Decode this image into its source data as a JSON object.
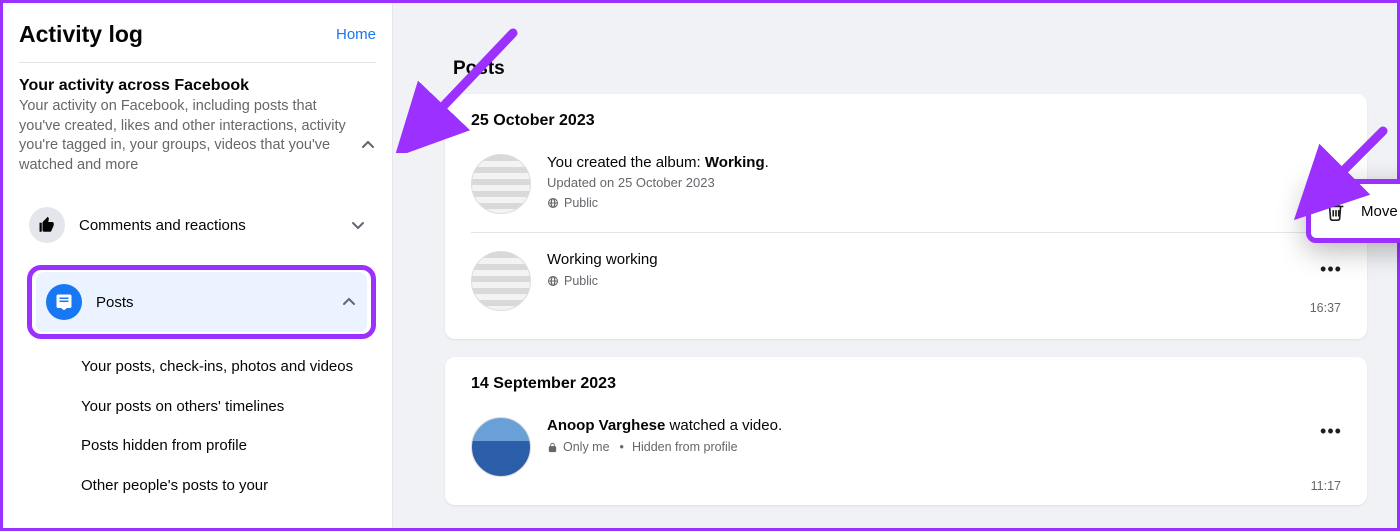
{
  "sidebar": {
    "title": "Activity log",
    "home": "Home",
    "section_title": "Your activity across Facebook",
    "section_desc": "Your activity on Facebook, including posts that you've created, likes and other interactions, activity you're tagged in, your groups, videos that you've watched and more",
    "items": [
      {
        "label": "Comments and reactions"
      },
      {
        "label": "Posts"
      }
    ],
    "subitems": [
      "Your posts, check-ins, photos and videos",
      "Your posts on others' timelines",
      "Posts hidden from profile",
      "Other people's posts to your"
    ]
  },
  "main": {
    "heading": "Posts",
    "groups": [
      {
        "date": "25 October 2023",
        "entries": [
          {
            "prefix": "You created the album: ",
            "bold": "Working",
            "suffix": ".",
            "sub": "Updated on 25 October 2023",
            "privacy_icon": "globe",
            "privacy": "Public",
            "time": ""
          },
          {
            "prefix": "Working working",
            "bold": "",
            "suffix": "",
            "sub": "",
            "privacy_icon": "globe",
            "privacy": "Public",
            "time": "16:37"
          }
        ]
      },
      {
        "date": "14 September 2023",
        "entries": [
          {
            "prefix_bold": "Anoop Varghese",
            "mid": " watched a ",
            "link": "video",
            "suffix": ".",
            "privacy_icon": "lock",
            "privacy": "Only me",
            "extra": "Hidden from profile",
            "time": "11:17"
          }
        ]
      }
    ]
  },
  "popover": {
    "label": "Move to Recycle bin"
  }
}
